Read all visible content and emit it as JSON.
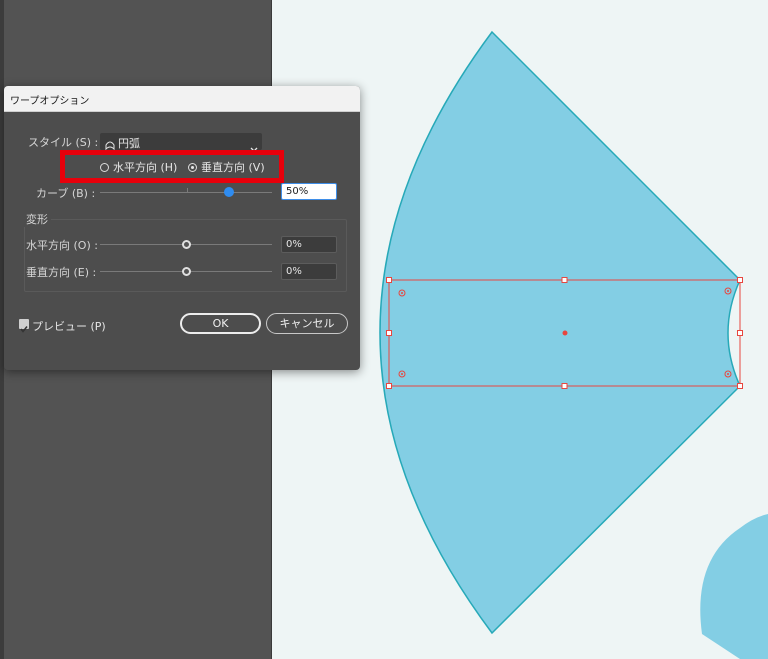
{
  "dialog": {
    "title": "ワープオプション",
    "style_label": "スタイル (S) :",
    "style_value": "円弧",
    "style_icon": "arc-warp-icon",
    "orientation": {
      "horizontal_label": "水平方向 (H)",
      "vertical_label": "垂直方向 (V)",
      "selected": "vertical"
    },
    "bend": {
      "label": "カーブ (B) :",
      "value": "50%",
      "level_percent": 50
    },
    "distortion": {
      "group_label": "変形",
      "horizontal": {
        "label": "水平方向 (O) :",
        "value": "0%",
        "level_percent": 0
      },
      "vertical": {
        "label": "垂直方向 (E) :",
        "value": "0%",
        "level_percent": 0
      }
    },
    "preview": {
      "label": "プレビュー (P)",
      "checked": true
    },
    "ok_label": "OK",
    "cancel_label": "キャンセル"
  },
  "colors": {
    "shape_fill": "#83cee4",
    "shape_stroke": "#27a9b8",
    "selection": "#e8463f",
    "highlight": "#e8000b",
    "slider_active": "#2f8cf0"
  }
}
